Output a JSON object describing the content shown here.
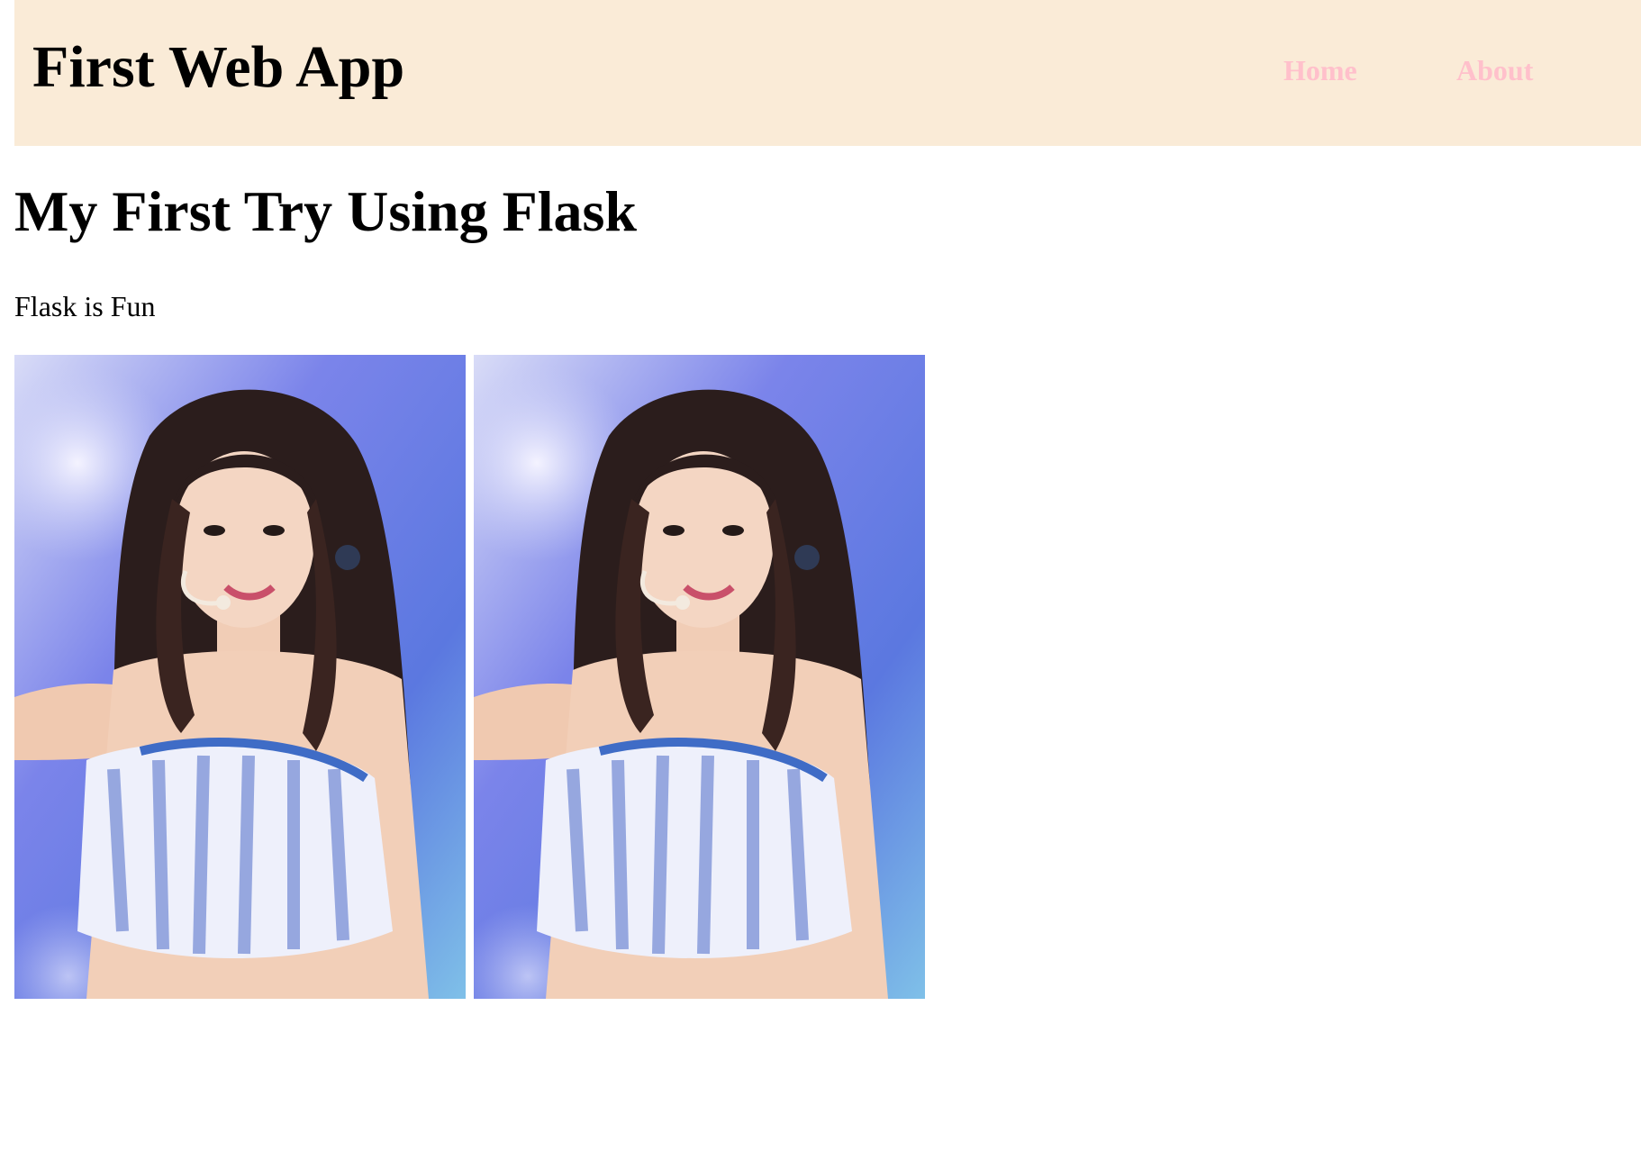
{
  "header": {
    "site_title": "First Web App",
    "background_color": "#faebd7",
    "nav": {
      "home_label": "Home",
      "about_label": "About",
      "link_color": "#ffc0cb"
    }
  },
  "main": {
    "heading": "My First Try Using Flask",
    "tagline": "Flask is Fun"
  },
  "images": [
    {
      "alt": "Performer on stage with headset microphone"
    },
    {
      "alt": "Performer on stage with headset microphone"
    }
  ]
}
